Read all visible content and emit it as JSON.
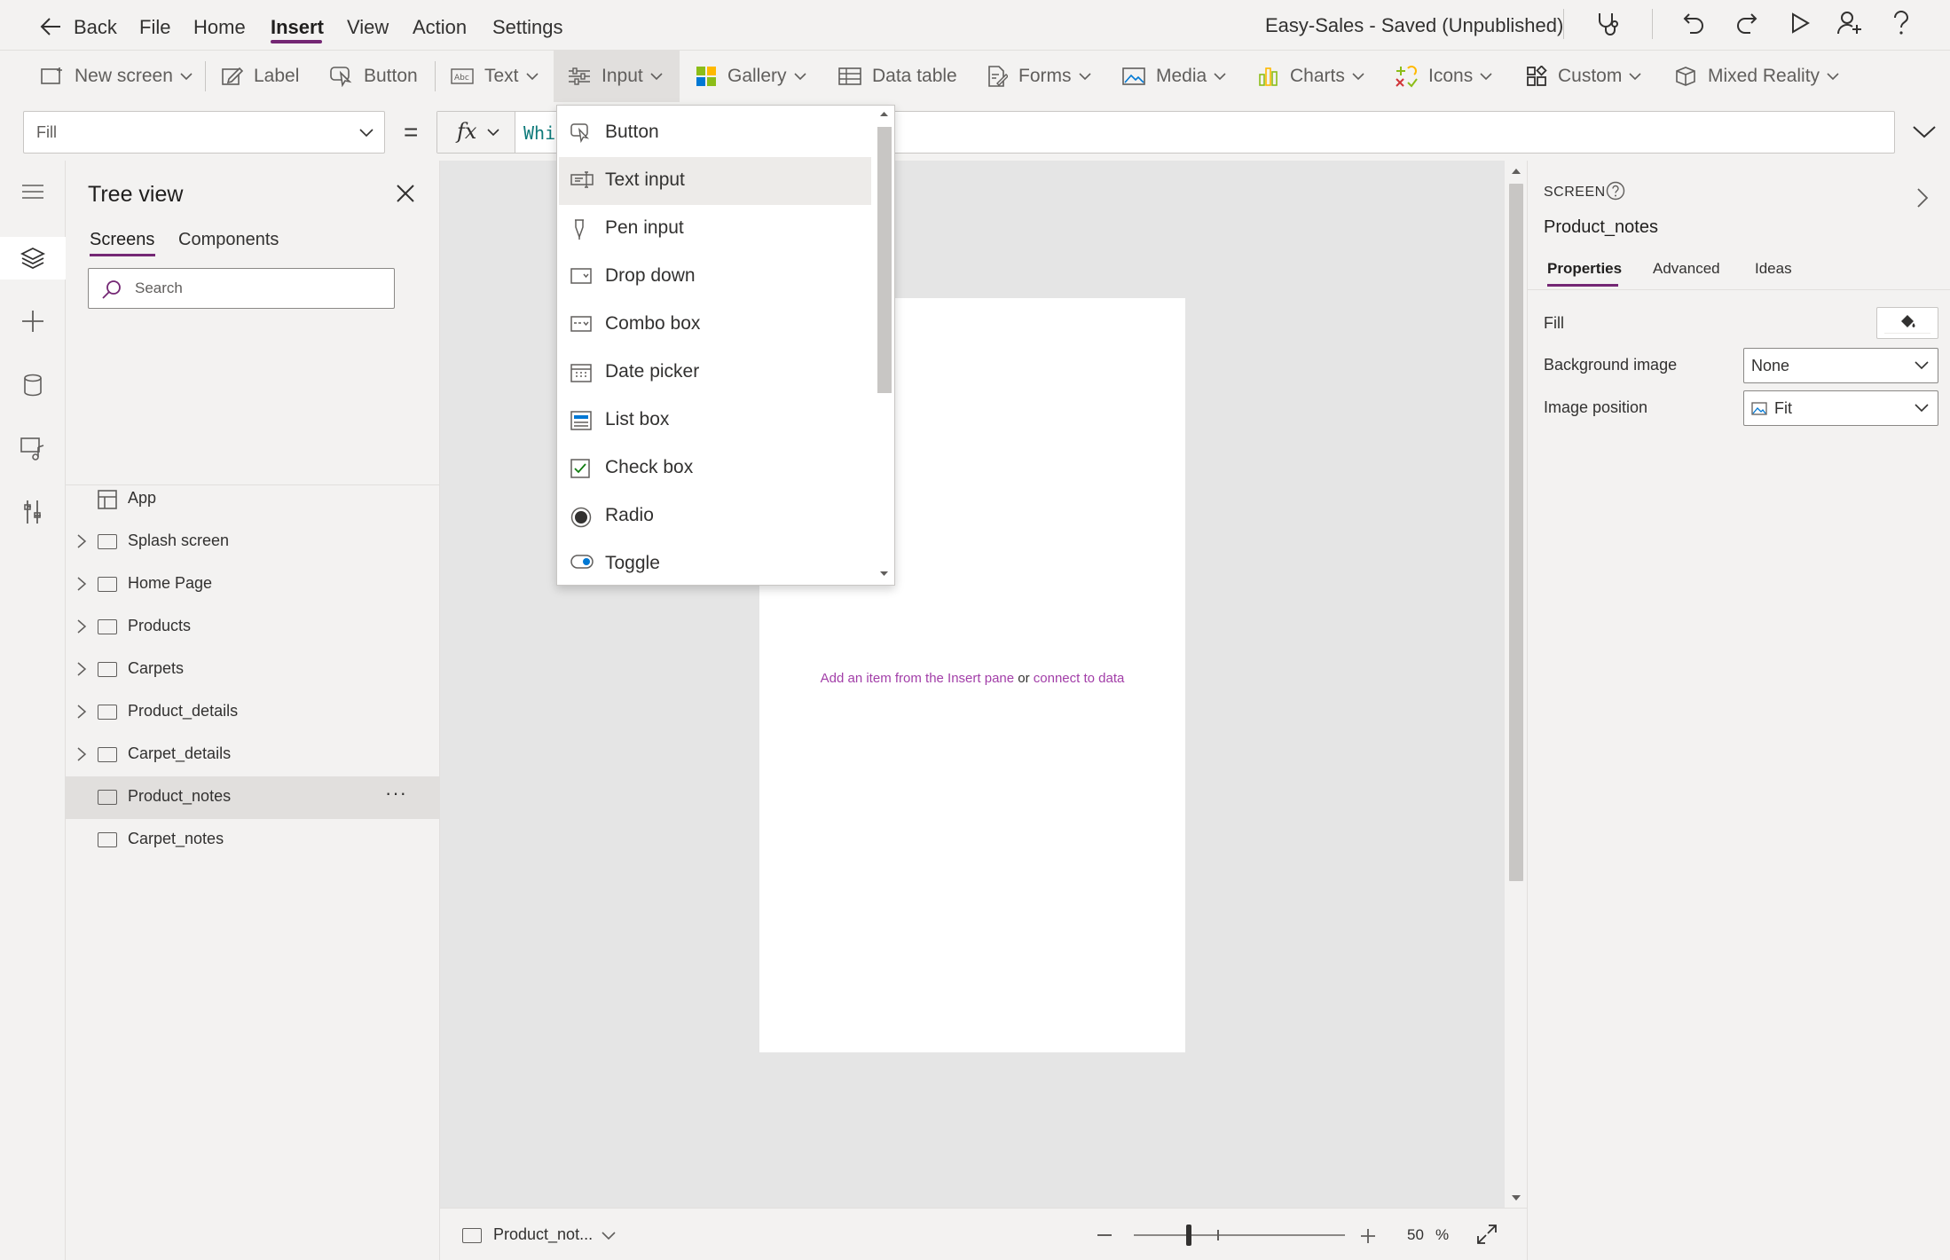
{
  "menu": {
    "back_label": "Back",
    "items": [
      "File",
      "Home",
      "Insert",
      "View",
      "Action",
      "Settings"
    ],
    "active": "Insert",
    "app_title": "Easy-Sales - Saved (Unpublished)"
  },
  "ribbon": {
    "new_screen": "New screen",
    "label": "Label",
    "button": "Button",
    "text": "Text",
    "input": "Input",
    "gallery": "Gallery",
    "data_table": "Data table",
    "forms": "Forms",
    "media": "Media",
    "charts": "Charts",
    "icons": "Icons",
    "custom": "Custom",
    "mixed_reality": "Mixed Reality"
  },
  "formula": {
    "property": "Fill",
    "equals": "=",
    "fx": "fx",
    "value": "Whi"
  },
  "tree": {
    "title": "Tree view",
    "tabs": [
      "Screens",
      "Components"
    ],
    "search_placeholder": "Search",
    "app_label": "App",
    "screens": [
      "Splash screen",
      "Home Page",
      "Products",
      "Carpets",
      "Product_details",
      "Carpet_details",
      "Product_notes",
      "Carpet_notes"
    ],
    "selected": "Product_notes",
    "more": "···"
  },
  "input_menu": {
    "items": [
      "Button",
      "Text input",
      "Pen input",
      "Drop down",
      "Combo box",
      "Date picker",
      "List box",
      "Check box",
      "Radio",
      "Toggle"
    ],
    "highlighted": "Text input"
  },
  "canvas": {
    "hint_link1": "Add an item from the Insert pane",
    "hint_or": " or ",
    "hint_link2": "connect to data"
  },
  "bottombar": {
    "screen_name": "Product_not...",
    "zoom_value": "50",
    "zoom_unit": "%"
  },
  "props": {
    "section": "SCREEN",
    "screen_name": "Product_notes",
    "tabs": [
      "Properties",
      "Advanced",
      "Ideas"
    ],
    "active_tab": "Properties",
    "fill_label": "Fill",
    "bg_image_label": "Background image",
    "bg_image_value": "None",
    "image_pos_label": "Image position",
    "image_pos_value": "Fit"
  },
  "colors": {
    "accent": "#742774",
    "link": "#a23ea8",
    "formula_text": "#0e7a7a"
  }
}
